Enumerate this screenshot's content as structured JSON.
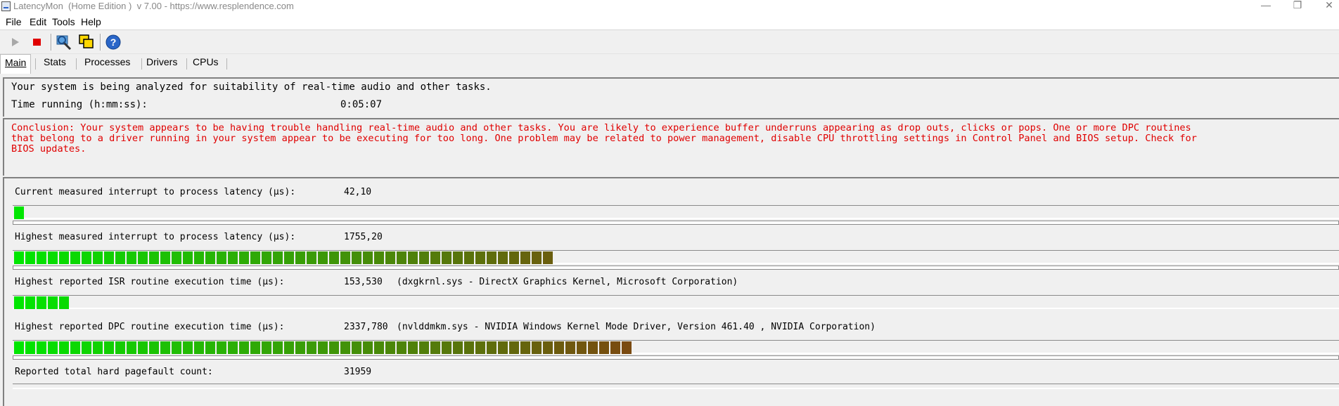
{
  "window": {
    "title": "LatencyMon  (Home Edition )  v 7.00 - https://www.resplendence.com",
    "minimize": "—",
    "restore": "❐",
    "close": "✕"
  },
  "menu": [
    "File",
    "Edit",
    "Tools",
    "Help"
  ],
  "toolbar": {
    "start": "play-icon",
    "stop": "stop-icon",
    "drivers": "driver-info-icon",
    "windows": "window-icon",
    "help": "help-icon"
  },
  "tabs": [
    "Main",
    "Stats",
    "Processes",
    "Drivers",
    "CPUs"
  ],
  "status": {
    "summary": "Your system is being analyzed for suitability of real-time audio and other tasks.",
    "time_label": "Time running (h:mm:ss):",
    "time_value": "0:05:07"
  },
  "conclusion": {
    "line1": "Conclusion: Your system appears to be having trouble handling real-time audio and other tasks. You are likely to experience buffer underruns appearing as drop outs, clicks or pops. One or more DPC routines",
    "line2": "that belong to a driver running in your system appear to be executing for too long. One problem may be related to power management, disable CPU throttling settings in Control Panel and BIOS setup. Check for",
    "line3": "BIOS updates.",
    "color": "#e00000"
  },
  "metrics": [
    {
      "label": "Current measured interrupt to process latency (µs):",
      "value": "42,10",
      "detail": "",
      "level_segments": 1
    },
    {
      "label": "Highest measured interrupt to process latency (µs):",
      "value": "1755,20",
      "detail": "",
      "level_segments": 48
    },
    {
      "label": "Highest reported ISR routine execution time (µs):",
      "value": "153,530",
      "detail": "(dxgkrnl.sys - DirectX Graphics Kernel, Microsoft Corporation)",
      "level_segments": 5
    },
    {
      "label": "Highest reported DPC routine execution time (µs):",
      "value": "2337,780",
      "detail": "(nvlddmkm.sys - NVIDIA Windows Kernel Mode Driver, Version 461.40 , NVIDIA Corporation)",
      "level_segments": 55
    },
    {
      "label": "Reported total hard pagefault count:",
      "value": "31959",
      "detail": "",
      "level_segments": 0
    }
  ],
  "colors": {
    "bar_start": "#00e600",
    "bar_end": "#7a4a10"
  }
}
